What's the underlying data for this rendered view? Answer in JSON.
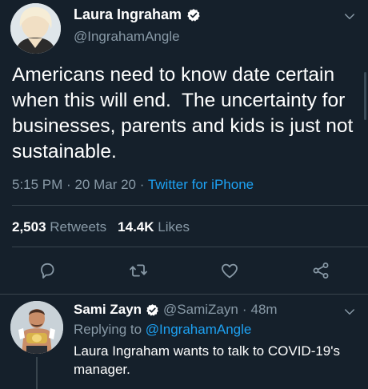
{
  "tweet": {
    "author": {
      "name": "Laura Ingraham",
      "handle": "@IngrahamAngle",
      "verified": true,
      "avatar": "profile-photo-woman"
    },
    "text": "Americans need to know date certain when this will end.  The uncertainty for businesses, parents and kids is just not sustainable.",
    "meta": {
      "time": "5:15 PM",
      "separator": "·",
      "date": "20 Mar 20",
      "source": "Twitter for iPhone"
    },
    "stats": {
      "retweets_count": "2,503",
      "retweets_label": "Retweets",
      "likes_count": "14.4K",
      "likes_label": "Likes"
    },
    "actions": [
      "reply-icon",
      "retweet-icon",
      "like-icon",
      "share-icon"
    ]
  },
  "reply": {
    "author": {
      "name": "Sami Zayn",
      "handle": "@SamiZayn",
      "verified": true,
      "avatar": "profile-photo-wrestler"
    },
    "time": "48m",
    "separator": "·",
    "replying_prefix": "Replying to",
    "replying_to": "@IngrahamAngle",
    "text": "Laura Ingraham wants to talk to COVID-19's manager."
  },
  "colors": {
    "background": "#15202b",
    "text_primary": "#ffffff",
    "text_secondary": "#8899a6",
    "accent": "#1da1f2",
    "divider": "#38444d"
  }
}
